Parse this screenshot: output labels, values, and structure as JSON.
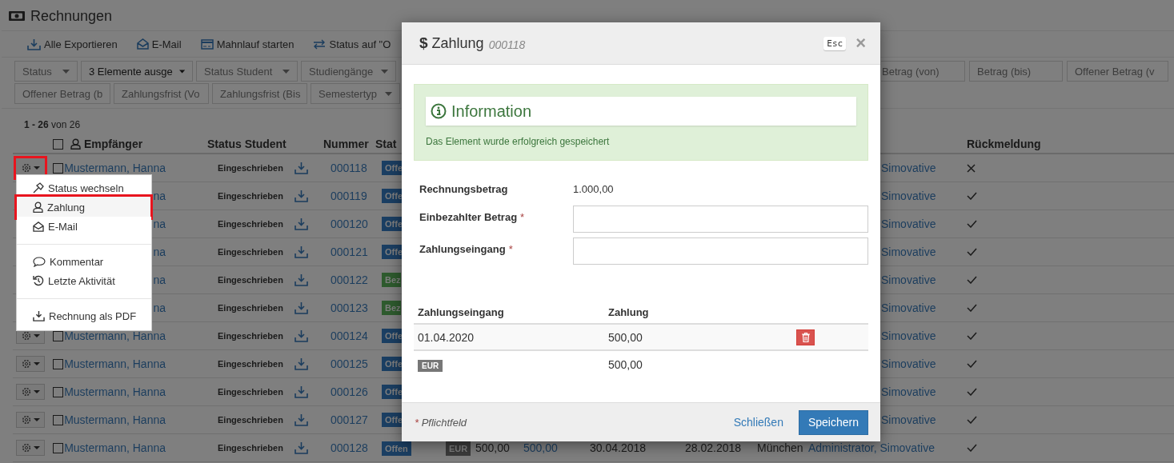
{
  "page": {
    "title": "Rechnungen"
  },
  "toolbar": [
    {
      "label": "Alle Exportieren"
    },
    {
      "label": "E-Mail"
    },
    {
      "label": "Mahnlauf starten"
    },
    {
      "label": "Status auf \"O"
    }
  ],
  "filters": {
    "left": [
      [
        {
          "kind": "select",
          "placeholder": "Status"
        },
        {
          "kind": "select",
          "value": "3 Elemente ausge"
        },
        {
          "kind": "select",
          "placeholder": "Status Student"
        },
        {
          "kind": "select",
          "placeholder": "Studiengänge"
        }
      ],
      [
        {
          "kind": "input",
          "placeholder": "Offener Betrag (b"
        },
        {
          "kind": "input",
          "placeholder": "Zahlungsfrist (Vo"
        },
        {
          "kind": "input",
          "placeholder": "Zahlungsfrist (Bis"
        },
        {
          "kind": "select",
          "placeholder": "Semestertyp"
        }
      ]
    ],
    "right": [
      {
        "placeholder": "Betrag (von)"
      },
      {
        "placeholder": "Betrag (bis)"
      },
      {
        "placeholder": "Offener Betrag (v"
      }
    ]
  },
  "count": "**1 - 26** von 26",
  "table": {
    "columns": [
      "Empfänger",
      "Status Student",
      "Nummer",
      "Stat"
    ],
    "right_columns": [
      "Rückmeldung"
    ],
    "all_checked": false,
    "rows": [
      {
        "checked": false,
        "name": "Mustermann, Hanna",
        "student_status": "Eingeschrieben",
        "number": "000118",
        "status": "Offe",
        "color": "#1b3f63",
        "author": "Simovative",
        "confirmed": false
      },
      {
        "name": "na",
        "student_status": "Eingeschrieben",
        "number": "000119",
        "status": "Offe",
        "color": "#1b3f63",
        "author": "Simovative",
        "confirmed": true
      },
      {
        "name": "na",
        "student_status": "Eingeschrieben",
        "number": "000120",
        "status": "Offe",
        "color": "#1b3f63",
        "author": "Simovative",
        "confirmed": true
      },
      {
        "name": "na",
        "student_status": "Eingeschrieben",
        "number": "000121",
        "status": "Offe",
        "color": "#1b3f63",
        "author": "Simovative",
        "confirmed": true
      },
      {
        "name": "na",
        "student_status": "Eingeschrieben",
        "number": "000122",
        "status": "Bez",
        "color": "#2e5b2e",
        "author": "Simovative",
        "confirmed": true
      },
      {
        "name": "na",
        "student_status": "Eingeschrieben",
        "number": "000123",
        "status": "Bez",
        "color": "#2e5b2e",
        "author": "Simovative",
        "confirmed": true
      },
      {
        "checked": false,
        "name": "Mustermann, Hanna",
        "student_status": "Eingeschrieben",
        "number": "000124",
        "status": "Offe",
        "color": "#1b3f63",
        "author": "Simovative",
        "confirmed": true
      },
      {
        "checked": false,
        "name": "Mustermann, Hanna",
        "student_status": "Eingeschrieben",
        "number": "000125",
        "status": "Offe",
        "color": "#1b3f63",
        "author": "Simovative",
        "confirmed": true
      },
      {
        "checked": false,
        "name": "Mustermann, Hanna",
        "student_status": "Eingeschrieben",
        "number": "000126",
        "status": "Offe",
        "color": "#1b3f63",
        "author": "Simovative",
        "confirmed": true
      },
      {
        "checked": false,
        "name": "Mustermann, Hanna",
        "student_status": "Eingeschrieben",
        "number": "000127",
        "status": "Offe",
        "color": "#1b3f63",
        "author": "Simovative",
        "confirmed": true
      },
      {
        "checked": false,
        "name": "Mustermann, Hanna",
        "student_status": "Eingeschrieben",
        "number": "000128",
        "status": "Offen",
        "color": "#1b3f63",
        "currency": "EUR",
        "amount": "500,00",
        "paid": "500,00",
        "due": "30.04.2018",
        "date": "28.02.2018",
        "location": "München",
        "author": "Administrator, Simovative",
        "confirmed": true
      }
    ]
  },
  "menu": {
    "open": true,
    "groups": [
      [
        {
          "label": "Status wechseln",
          "highlighted": false
        },
        {
          "label": "Zahlung",
          "highlighted": true
        },
        {
          "label": "E-Mail",
          "highlighted": false
        }
      ],
      [
        {
          "label": "Kommentar",
          "highlighted": false
        },
        {
          "label": "Letzte Aktivität",
          "highlighted": false
        }
      ],
      [
        {
          "label": "Rechnung als PDF",
          "highlighted": false
        }
      ]
    ]
  },
  "modal": {
    "icon": "$",
    "title": "Zahlung",
    "number": "000118",
    "esc": "Esc",
    "close": "×",
    "alert": {
      "title": "Information",
      "message": "Das Element wurde erfolgreich gespeichert"
    },
    "required_mark": "*",
    "fields": [
      {
        "label": "Rechnungsbetrag",
        "kind": "static",
        "value": "1.000,00",
        "required": false
      },
      {
        "label": "Einbezahlter Betrag",
        "kind": "input",
        "required": true
      },
      {
        "label": "Zahlungseingang",
        "kind": "input",
        "required": true
      }
    ],
    "payments": {
      "columns": [
        "Zahlungseingang",
        "Zahlung"
      ],
      "rows": [
        {
          "date": "01.04.2020",
          "amount": "500,00"
        }
      ],
      "total": {
        "currency": "EUR",
        "amount": "500,00"
      }
    },
    "footer": {
      "note": "Pflichtfeld",
      "close": "Schließen",
      "save": "Speichern"
    }
  }
}
